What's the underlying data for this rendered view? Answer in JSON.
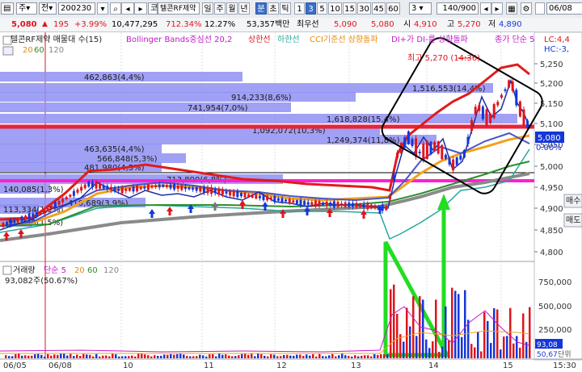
{
  "toolbar": {
    "market": "주",
    "period": "전",
    "code": "200230",
    "kind": "코",
    "name": "텔콘RF제약",
    "tf_day": "일",
    "tf_week": "주",
    "tf_month": "월",
    "tf_year": "년",
    "tf_min": "분",
    "tf_sec": "초",
    "tf_tick": "틱",
    "intervals": [
      "1",
      "3",
      "5",
      "10",
      "15",
      "30",
      "45",
      "60"
    ],
    "selected_interval": "3",
    "interval_select": "3",
    "count": "140/900",
    "date_field": "06/08"
  },
  "quote": {
    "price": "5,080",
    "change": "195",
    "change_pct": "+3.99%",
    "volume": "10,477,295",
    "volume_ratio": "712.34%",
    "turnover": "12.27%",
    "amount": "53,357백만",
    "best_ask_label": "최우선",
    "best_ask": "5,090",
    "best_bid": "5,080",
    "open_label": "시",
    "open": "4,910",
    "high_label": "고",
    "high": "5,270",
    "low_label": "저",
    "low": "4,890"
  },
  "legend": {
    "title": "텔콘RF제약 매물대 수(15)",
    "bb": "Bollinger Bands중심선 20,2",
    "bb_upper": "상한선",
    "bb_lower": "하한선",
    "cci": "CCI기준선 상향돌파",
    "dmi": "DI+가 DI-를 상향돌파",
    "close_ma": "종가 단순 5",
    "ma20": "20",
    "ma60": "60",
    "ma120": "120",
    "lc": "LC:4,4",
    "hc": "HC:-3,"
  },
  "annotations": {
    "high_marker": "최고 5,270 (14:36)",
    "current_price_tag": "5,080",
    "current_pct_tag": "0.00%"
  },
  "volume_profile": [
    {
      "label": "462,863(4,4%)"
    },
    {
      "label": "1,516,553(14,4%)"
    },
    {
      "label": "914,233(8,6%)"
    },
    {
      "label": "741,954(7,0%)"
    },
    {
      "label": "1,618,828(15,4%)"
    },
    {
      "label": "1,092,072(10,3%)"
    },
    {
      "label": "1,249,374(11,8%)"
    },
    {
      "label": "463,635(4,4%)"
    },
    {
      "label": "566,848(5,3%)"
    },
    {
      "label": "481,980(4,5%)"
    },
    {
      "label": "713,890(6,8%)"
    },
    {
      "label": "140,085(1,3%)"
    },
    {
      "label": "410,689(3,9%)"
    },
    {
      "label": "113,334(1,1%)"
    },
    {
      "label": "90,345(1,5%)"
    }
  ],
  "price_axis": [
    "5,250",
    "5,200",
    "5,150",
    "5,100",
    "5,050",
    "5,000",
    "4,950",
    "4,900",
    "4,850",
    "4,800"
  ],
  "volume_panel": {
    "legend_title": "거래량",
    "legend_ma5": "단순 5",
    "legend_ma20": "20",
    "legend_ma60": "60",
    "legend_ma120": "120",
    "current": "93,082주(50.67%)",
    "axis": [
      "750,000",
      "500,000",
      "250,000"
    ],
    "axis_tag_1": "93,08",
    "axis_tag_2": "50,67",
    "unit": "단위"
  },
  "x_axis": {
    "labels": [
      "06/05",
      "06/08",
      "10",
      "11",
      "12",
      "13",
      "14",
      "15"
    ],
    "time": "15:30"
  },
  "side_buttons": [
    "매수",
    "매도"
  ],
  "colors": {
    "up": "#e0141e",
    "down": "#1437d8",
    "volume_profile": "#8f8ff2",
    "annotation_green": "#22dd22",
    "resistance": "#e8233a",
    "support_pink": "#ff1fcf"
  }
}
